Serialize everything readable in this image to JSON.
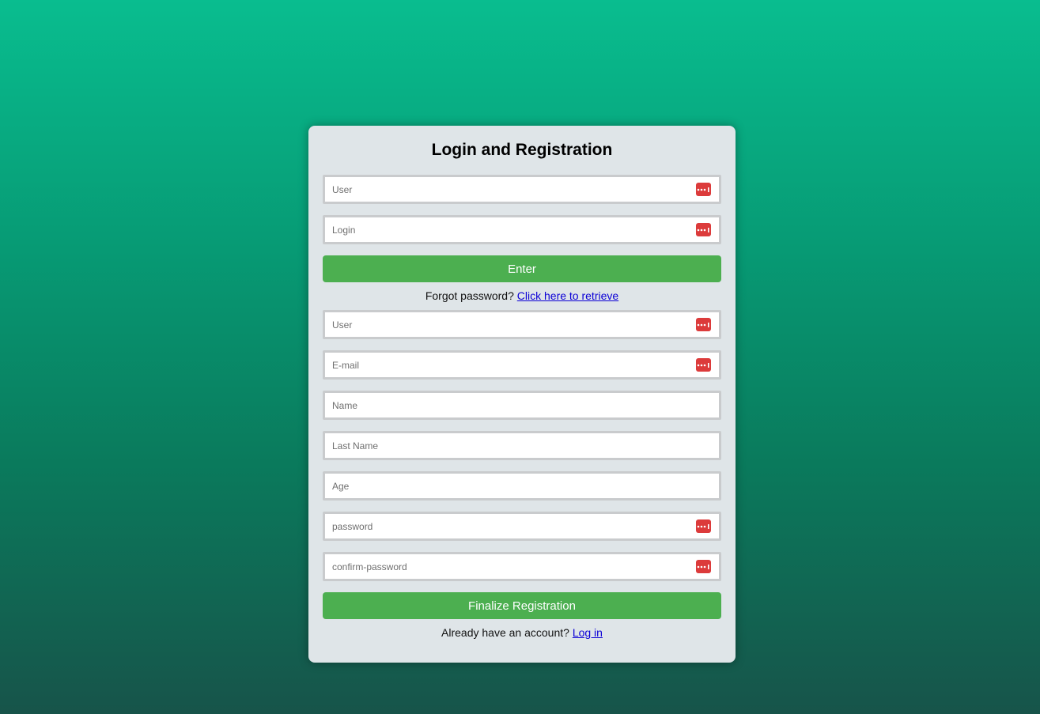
{
  "card": {
    "title": "Login and Registration"
  },
  "login": {
    "user_placeholder": "User",
    "login_placeholder": "Login",
    "enter_label": "Enter",
    "forgot_text": "Forgot password?",
    "forgot_link": "Click here to retrieve"
  },
  "register": {
    "user_placeholder": "User",
    "email_placeholder": "E-mail",
    "name_placeholder": "Name",
    "lastname_placeholder": "Last Name",
    "age_placeholder": "Age",
    "password_placeholder": "password",
    "confirm_placeholder": "confirm-password",
    "finalize_label": "Finalize Registration",
    "account_text": "Already have an account?",
    "login_link": "Log in"
  },
  "icons": {
    "password_manager": "password-manager-icon"
  },
  "colors": {
    "accent_button": "#4caf50",
    "card_bg": "#dfe5e8",
    "icon_red": "#dc3b3b",
    "link": "#0b00d6"
  }
}
